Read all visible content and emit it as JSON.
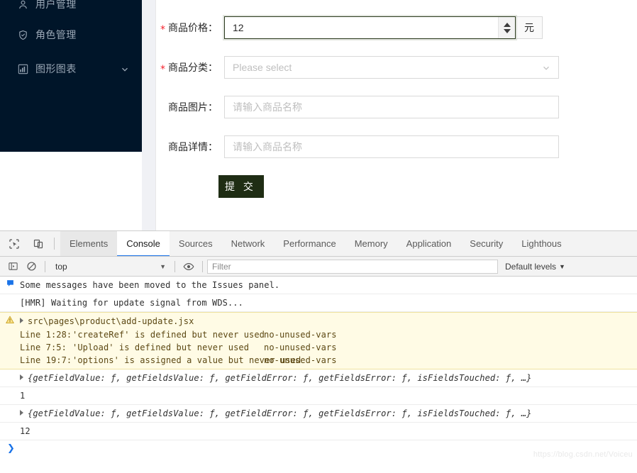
{
  "sidebar": {
    "items": [
      {
        "label": "用户管理",
        "icon": "user-icon",
        "has_caret": false
      },
      {
        "label": "角色管理",
        "icon": "shield-check-icon",
        "has_caret": false
      },
      {
        "label": "图形图表",
        "icon": "bar-chart-icon",
        "has_caret": true
      }
    ]
  },
  "form": {
    "required_marker": "*",
    "fields": [
      {
        "label": "商品价格：",
        "required": true,
        "type": "number",
        "value": "12",
        "placeholder": "",
        "addon": "元"
      },
      {
        "label": "商品分类：",
        "required": true,
        "type": "select",
        "value": "",
        "placeholder": "Please select"
      },
      {
        "label": "商品图片：",
        "required": false,
        "type": "text",
        "value": "",
        "placeholder": "请输入商品名称"
      },
      {
        "label": "商品详情：",
        "required": false,
        "type": "text",
        "value": "",
        "placeholder": "请输入商品名称"
      }
    ],
    "submit_label": "提 交"
  },
  "devtools": {
    "tabs": [
      {
        "label": "Elements",
        "state": "hovered"
      },
      {
        "label": "Console",
        "state": "active"
      },
      {
        "label": "Sources",
        "state": "normal"
      },
      {
        "label": "Network",
        "state": "normal"
      },
      {
        "label": "Performance",
        "state": "normal"
      },
      {
        "label": "Memory",
        "state": "normal"
      },
      {
        "label": "Application",
        "state": "normal"
      },
      {
        "label": "Security",
        "state": "normal"
      },
      {
        "label": "Lighthous",
        "state": "normal"
      }
    ],
    "toolbar": {
      "context": "top",
      "context_caret": "▼",
      "filter_placeholder": "Filter",
      "levels_label": "Default levels",
      "levels_caret": "▼"
    },
    "console": {
      "messages": [
        {
          "kind": "info",
          "icon": "issues-flag-icon",
          "text": "Some messages have been moved to the Issues panel."
        },
        {
          "kind": "log",
          "icon": "",
          "text": "[HMR] Waiting for update signal from WDS..."
        },
        {
          "kind": "warning",
          "icon": "warning-triangle-icon",
          "title": "src\\pages\\product\\add-update.jsx",
          "lines": [
            {
              "pos": "Line 1:28:",
              "msg": "'createRef' is defined but never used",
              "rule": "no-unused-vars"
            },
            {
              "pos": "Line 7:5:",
              "msg": "'Upload' is defined but never used",
              "rule": "no-unused-vars"
            },
            {
              "pos": "Line 19:7:",
              "msg": "'options' is assigned a value but never used",
              "rule": "no-unused-vars"
            }
          ]
        },
        {
          "kind": "object",
          "icon": "",
          "text": "{getFieldValue: ƒ, getFieldsValue: ƒ, getFieldError: ƒ, getFieldsError: ƒ, isFieldsTouched: ƒ, …}"
        },
        {
          "kind": "value",
          "icon": "",
          "text": "1"
        },
        {
          "kind": "object",
          "icon": "",
          "text": "{getFieldValue: ƒ, getFieldsValue: ƒ, getFieldError: ƒ, getFieldsError: ƒ, isFieldsTouched: ƒ, …}"
        },
        {
          "kind": "value",
          "icon": "",
          "text": "12"
        }
      ],
      "prompt": "❯"
    }
  },
  "watermark": "https://blog.csdn.net/Voiceu",
  "colors": {
    "sidebar_bg": "#001529",
    "accent_tab": "#1a73e8",
    "required_star": "#f5222d",
    "submit_bg": "#1f2d14",
    "warning_bg": "#fffbe5"
  }
}
